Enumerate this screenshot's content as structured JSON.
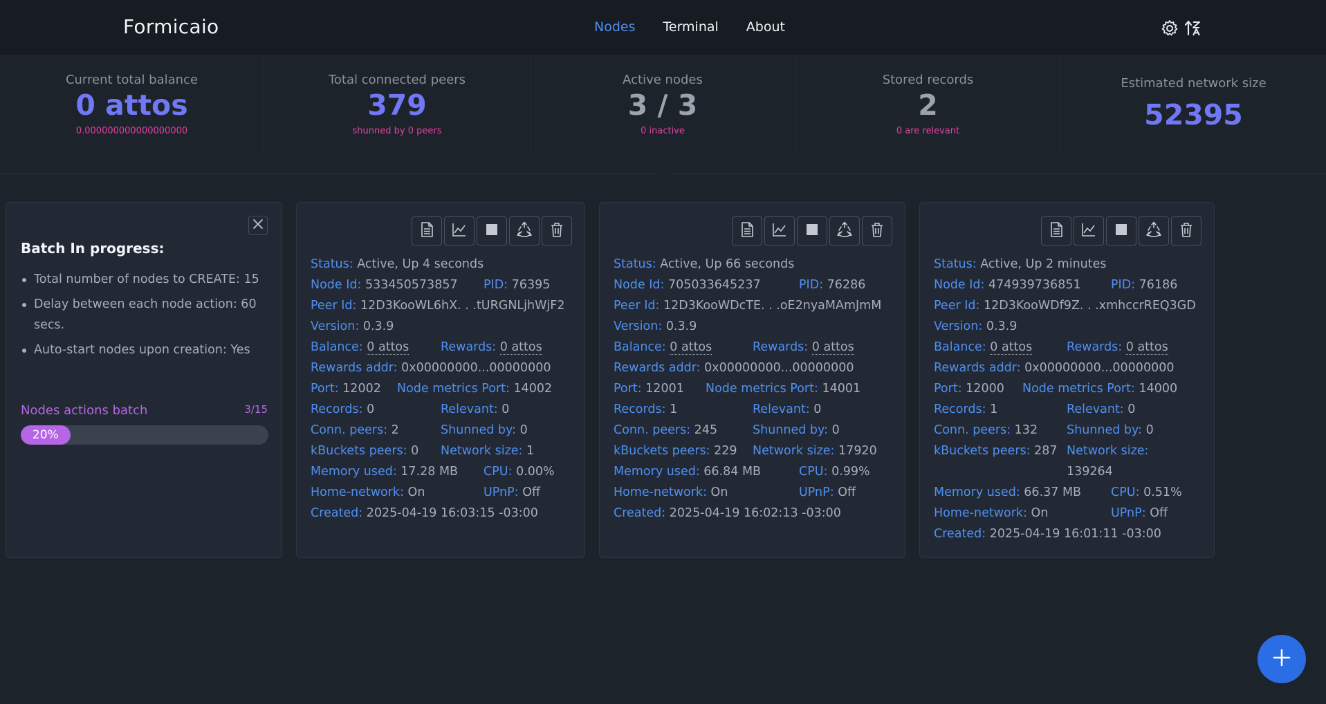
{
  "app": {
    "brand": "Formicaio",
    "nav": [
      {
        "label": "Nodes",
        "active": true
      },
      {
        "label": "Terminal",
        "active": false
      },
      {
        "label": "About",
        "active": false
      }
    ],
    "icons": [
      "gear-icon",
      "sort-alpha-icon"
    ]
  },
  "stats": {
    "balance": {
      "title": "Current total balance",
      "value": "0 attos",
      "desc": "0.000000000000000000"
    },
    "peers": {
      "title": "Total connected peers",
      "value": "379",
      "desc": "shunned by 0 peers"
    },
    "active": {
      "title": "Active nodes",
      "value": "3 / 3",
      "desc": "0 inactive"
    },
    "records": {
      "title": "Stored records",
      "value": "2",
      "desc": "0 are relevant"
    },
    "network": {
      "title": "Estimated network size",
      "value": "52395"
    }
  },
  "batch": {
    "title": "Batch In progress:",
    "items": [
      "Total number of nodes to CREATE: 15",
      "Delay between each node action: 60 secs.",
      "Auto-start nodes upon creation: Yes"
    ],
    "progress_label": "Nodes actions batch",
    "progress_count": "3/15",
    "progress_text": "20%",
    "progress_fraction": 0.2
  },
  "labels": {
    "status": "Status:",
    "node_id": "Node Id:",
    "pid": "PID:",
    "peer_id": "Peer Id:",
    "version": "Version:",
    "balance": "Balance:",
    "rewards": "Rewards:",
    "rewards_addr": "Rewards addr:",
    "port": "Port:",
    "metrics_port": "Node metrics Port:",
    "records": "Records:",
    "relevant": "Relevant:",
    "conn_peers": "Conn. peers:",
    "shunned_by": "Shunned by:",
    "kbuckets": "kBuckets peers:",
    "network_size": "Network size:",
    "memory": "Memory used:",
    "cpu": "CPU:",
    "home_network": "Home-network:",
    "upnp": "UPnP:",
    "created": "Created:"
  },
  "nodes": [
    {
      "status": "Active, Up 4 seconds",
      "node_id": "533450573857",
      "pid": "76395",
      "peer_id": "12D3KooWL6hX. . .tURGNLjhWjF2",
      "version": "0.3.9",
      "balance": "0 attos",
      "rewards": "0 attos",
      "rewards_addr": "0x00000000...00000000",
      "port": "12002",
      "metrics_port": "14002",
      "records": "0",
      "relevant": "0",
      "conn_peers": "2",
      "shunned_by": "0",
      "kbuckets": "0",
      "network_size": "1",
      "memory": "17.28 MB",
      "cpu": "0.00%",
      "home_network": "On",
      "upnp": "Off",
      "created": "2025-04-19 16:03:15 -03:00"
    },
    {
      "status": "Active, Up 66 seconds",
      "node_id": "705033645237",
      "pid": "76286",
      "peer_id": "12D3KooWDcTE. . .oE2nyaMAmJmM",
      "version": "0.3.9",
      "balance": "0 attos",
      "rewards": "0 attos",
      "rewards_addr": "0x00000000...00000000",
      "port": "12001",
      "metrics_port": "14001",
      "records": "1",
      "relevant": "0",
      "conn_peers": "245",
      "shunned_by": "0",
      "kbuckets": "229",
      "network_size": "17920",
      "memory": "66.84 MB",
      "cpu": "0.99%",
      "home_network": "On",
      "upnp": "Off",
      "created": "2025-04-19 16:02:13 -03:00"
    },
    {
      "status": "Active, Up 2 minutes",
      "node_id": "474939736851",
      "pid": "76186",
      "peer_id": "12D3KooWDf9Z. . .xmhccrREQ3GD",
      "version": "0.3.9",
      "balance": "0 attos",
      "rewards": "0 attos",
      "rewards_addr": "0x00000000...00000000",
      "port": "12000",
      "metrics_port": "14000",
      "records": "1",
      "relevant": "0",
      "conn_peers": "132",
      "shunned_by": "0",
      "kbuckets": "287",
      "network_size": "139264",
      "memory": "66.37 MB",
      "cpu": "0.51%",
      "home_network": "On",
      "upnp": "Off",
      "created": "2025-04-19 16:01:11 -03:00"
    }
  ],
  "colors": {
    "accent": "#4f8ff0",
    "stat_value": "#7178f6",
    "pink": "#e043a5",
    "purple": "#b565e5",
    "fab": "#2b6de5"
  }
}
